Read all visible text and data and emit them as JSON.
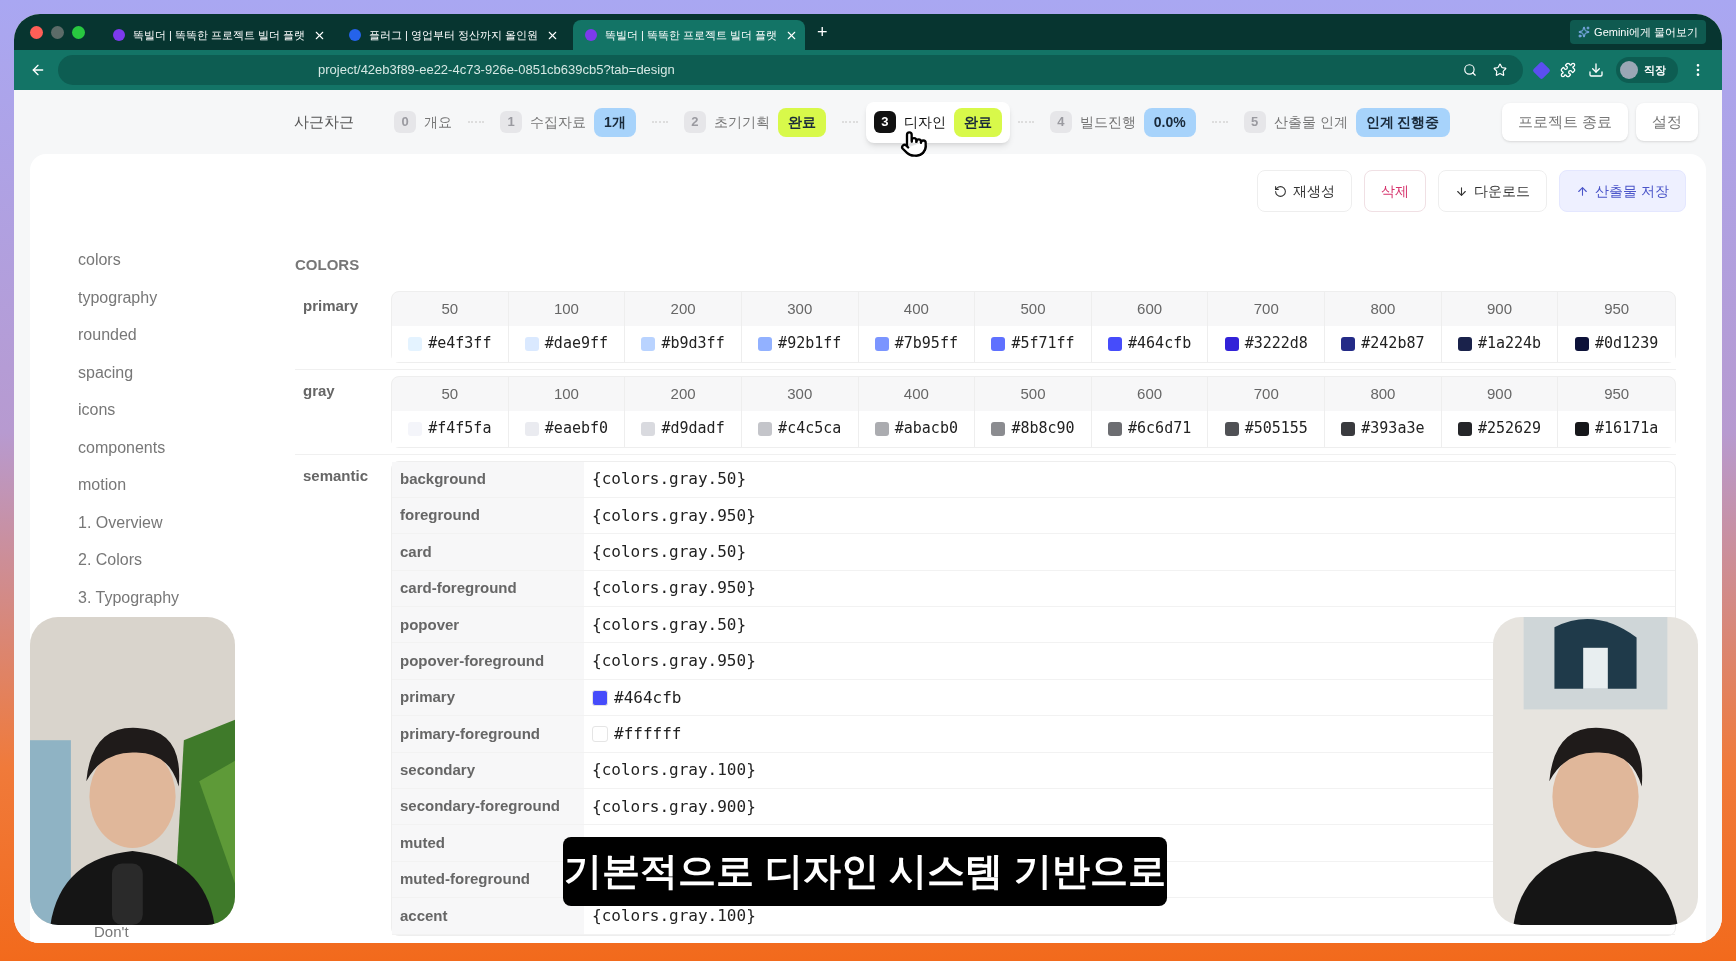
{
  "browser": {
    "tabs": [
      {
        "title": "똑빌더 | 똑똑한 프로젝트 빌더 플랫",
        "selected": false,
        "color": "#7c3aed"
      },
      {
        "title": "플러그 | 영업부터 정산까지 올인원",
        "selected": false,
        "color": "#2563eb"
      },
      {
        "title": "똑빌더 | 똑똑한 프로젝트 빌더 플랫",
        "selected": true,
        "color": "#7c3aed"
      }
    ],
    "new_tab": "+",
    "gemini": "Gemini에게 물어보기",
    "url": "project/42eb3f89-ee22-4c73-926e-0851cb639cb5?tab=design",
    "profile": "직장"
  },
  "header": {
    "project": "사근차근",
    "steps": [
      {
        "number": "0",
        "label": "개요",
        "selected": false
      },
      {
        "number": "1",
        "label": "수집자료",
        "badge": "1개",
        "color": "#a7d3fb",
        "selected": false
      },
      {
        "number": "2",
        "label": "초기기획",
        "badge": "완료",
        "color": "#d8f94a",
        "selected": false
      },
      {
        "number": "3",
        "label": "디자인",
        "badge": "완료",
        "color": "#d8f94a",
        "selected": true
      },
      {
        "number": "4",
        "label": "빌드진행",
        "badge": "0.0%",
        "color": "#a7d3fb",
        "selected": false
      },
      {
        "number": "5",
        "label": "산출물 인계",
        "badge": "인계 진행중",
        "color": "#a7d3fb",
        "selected": false
      }
    ],
    "actions": [
      "프로젝트 종료",
      "설정"
    ]
  },
  "toolbar": [
    {
      "label": "재생성",
      "kind": "regenerate"
    },
    {
      "label": "삭제",
      "kind": "danger"
    },
    {
      "label": "다운로드",
      "kind": "download"
    },
    {
      "label": "산출물 저장",
      "kind": "primary"
    }
  ],
  "sidebar": {
    "items": [
      "colors",
      "typography",
      "rounded",
      "spacing",
      "icons",
      "components",
      "motion",
      "1. Overview",
      "2. Colors",
      "3. Typography"
    ],
    "bottom_items": [
      "Don't"
    ]
  },
  "section_title": "COLORS",
  "palettes": [
    {
      "name": "primary",
      "swatches": [
        {
          "step": "50",
          "hex": "#e4f3ff",
          "color": "#e4f3ff"
        },
        {
          "step": "100",
          "hex": "#dae9ff",
          "color": "#dae9ff"
        },
        {
          "step": "200",
          "hex": "#b9d3ff",
          "color": "#b9d3ff"
        },
        {
          "step": "300",
          "hex": "#92b1ff",
          "color": "#92b1ff"
        },
        {
          "step": "400",
          "hex": "#7b95ff",
          "color": "#7b95ff"
        },
        {
          "step": "500",
          "hex": "#5f71ff",
          "color": "#5f71ff"
        },
        {
          "step": "600",
          "hex": "#464cfb",
          "color": "#464cfb"
        },
        {
          "step": "700",
          "hex": "#3222d8",
          "color": "#3222d8"
        },
        {
          "step": "800",
          "hex": "#242b87",
          "color": "#242b87"
        },
        {
          "step": "900",
          "hex": "#1a224b",
          "color": "#1a224b"
        },
        {
          "step": "950",
          "hex": "#0d1239",
          "color": "#0d1239"
        }
      ]
    },
    {
      "name": "gray",
      "swatches": [
        {
          "step": "50",
          "hex": "#f4f5fa",
          "color": "#f4f5fa"
        },
        {
          "step": "100",
          "hex": "#eaebf0",
          "color": "#eaebf0"
        },
        {
          "step": "200",
          "hex": "#d9dadf",
          "color": "#d9dadf"
        },
        {
          "step": "300",
          "hex": "#c4c5ca",
          "color": "#c4c5ca"
        },
        {
          "step": "400",
          "hex": "#abacb0",
          "color": "#abacb0"
        },
        {
          "step": "500",
          "hex": "#8b8c90",
          "color": "#8b8c90"
        },
        {
          "step": "600",
          "hex": "#6c6d71",
          "color": "#6c6d71"
        },
        {
          "step": "700",
          "hex": "#505155",
          "color": "#505155"
        },
        {
          "step": "800",
          "hex": "#393a3e",
          "color": "#393a3e"
        },
        {
          "step": "900",
          "hex": "#252629",
          "color": "#252629"
        },
        {
          "step": "950",
          "hex": "#16171a",
          "color": "#16171a"
        }
      ]
    }
  ],
  "semantic": {
    "name": "semantic",
    "rows": [
      {
        "token": "background",
        "value": "{colors.gray.50}"
      },
      {
        "token": "foreground",
        "value": "{colors.gray.950}"
      },
      {
        "token": "card",
        "value": "{colors.gray.50}"
      },
      {
        "token": "card-foreground",
        "value": "{colors.gray.950}"
      },
      {
        "token": "popover",
        "value": "{colors.gray.50}"
      },
      {
        "token": "popover-foreground",
        "value": "{colors.gray.950}"
      },
      {
        "token": "primary",
        "value": "#464cfb",
        "color": "#464cfb"
      },
      {
        "token": "primary-foreground",
        "value": "#ffffff",
        "color": "#ffffff"
      },
      {
        "token": "secondary",
        "value": "{colors.gray.100}"
      },
      {
        "token": "secondary-foreground",
        "value": "{colors.gray.900}"
      },
      {
        "token": "muted"
      },
      {
        "token": "muted-foreground"
      },
      {
        "token": "accent",
        "value": "{colors.gray.100}"
      }
    ]
  },
  "subtitle": "기본적으로 디자인 시스템 기반으로"
}
